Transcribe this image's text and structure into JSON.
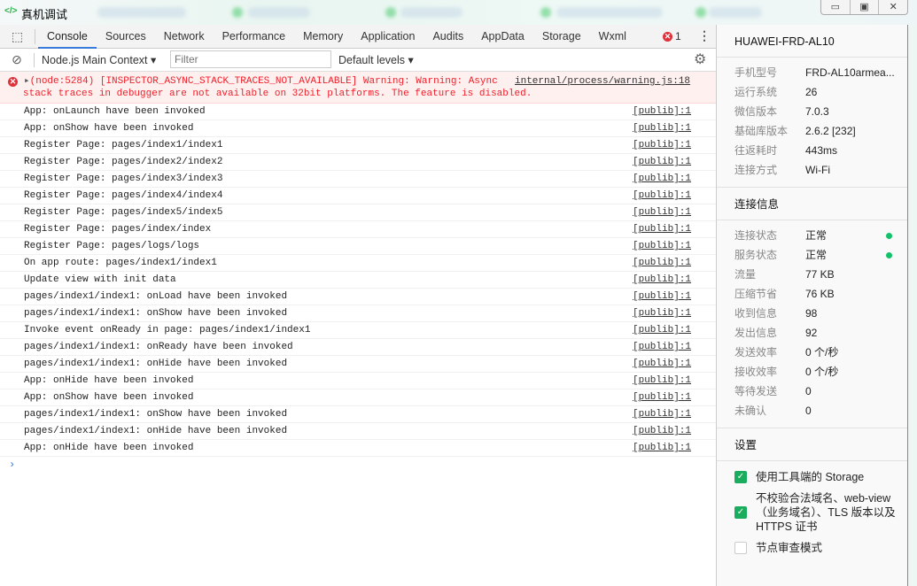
{
  "window": {
    "title": "真机调试",
    "icon": "code-icon",
    "controls": [
      "minimize",
      "maximize",
      "close"
    ]
  },
  "tabs": [
    "Console",
    "Sources",
    "Network",
    "Performance",
    "Memory",
    "Application",
    "Audits",
    "AppData",
    "Storage",
    "Wxml"
  ],
  "active_tab": "Console",
  "error_count": "1",
  "toolbar": {
    "context": "Node.js Main Context",
    "filter_placeholder": "Filter",
    "levels": "Default levels"
  },
  "error_entry": {
    "line1": "(node:5284) [INSPECTOR_ASYNC_STACK_TRACES_NOT_AVAILABLE] Warning: Warning: Async",
    "line2": "stack traces in debugger are not available on 32bit platforms. The feature is disabled.",
    "source": "internal/process/warning.js:18"
  },
  "logs": [
    {
      "msg": "App: onLaunch have been invoked",
      "src": "[publib]:1"
    },
    {
      "msg": "App: onShow have been invoked",
      "src": "[publib]:1"
    },
    {
      "msg": "Register Page: pages/index1/index1",
      "src": "[publib]:1"
    },
    {
      "msg": "Register Page: pages/index2/index2",
      "src": "[publib]:1"
    },
    {
      "msg": "Register Page: pages/index3/index3",
      "src": "[publib]:1"
    },
    {
      "msg": "Register Page: pages/index4/index4",
      "src": "[publib]:1"
    },
    {
      "msg": "Register Page: pages/index5/index5",
      "src": "[publib]:1"
    },
    {
      "msg": "Register Page: pages/index/index",
      "src": "[publib]:1"
    },
    {
      "msg": "Register Page: pages/logs/logs",
      "src": "[publib]:1"
    },
    {
      "msg": "On app route: pages/index1/index1",
      "src": "[publib]:1"
    },
    {
      "msg": "Update view with init data",
      "src": "[publib]:1"
    },
    {
      "msg": "pages/index1/index1: onLoad have been invoked",
      "src": "[publib]:1"
    },
    {
      "msg": "pages/index1/index1: onShow have been invoked",
      "src": "[publib]:1"
    },
    {
      "msg": "Invoke event onReady in page: pages/index1/index1",
      "src": "[publib]:1"
    },
    {
      "msg": "pages/index1/index1: onReady have been invoked",
      "src": "[publib]:1"
    },
    {
      "msg": "pages/index1/index1: onHide have been invoked",
      "src": "[publib]:1"
    },
    {
      "msg": "App: onHide have been invoked",
      "src": "[publib]:1"
    },
    {
      "msg": "App: onShow have been invoked",
      "src": "[publib]:1"
    },
    {
      "msg": "pages/index1/index1: onShow have been invoked",
      "src": "[publib]:1"
    },
    {
      "msg": "pages/index1/index1: onHide have been invoked",
      "src": "[publib]:1"
    },
    {
      "msg": "App: onHide have been invoked",
      "src": "[publib]:1"
    }
  ],
  "side": {
    "device": "HUAWEI-FRD-AL10",
    "info": [
      {
        "k": "手机型号",
        "v": "FRD-AL10armea..."
      },
      {
        "k": "运行系统",
        "v": "26"
      },
      {
        "k": "微信版本",
        "v": "7.0.3"
      },
      {
        "k": "基础库版本",
        "v": "2.6.2 [232]"
      },
      {
        "k": "往返耗时",
        "v": "443ms"
      },
      {
        "k": "连接方式",
        "v": "Wi-Fi"
      }
    ],
    "conn_title": "连接信息",
    "conn": [
      {
        "k": "连接状态",
        "v": "正常",
        "dot": true
      },
      {
        "k": "服务状态",
        "v": "正常",
        "dot": true
      },
      {
        "k": "流量",
        "v": "77 KB"
      },
      {
        "k": "压缩节省",
        "v": "76 KB"
      },
      {
        "k": "收到信息",
        "v": "98"
      },
      {
        "k": "发出信息",
        "v": "92"
      },
      {
        "k": "发送效率",
        "v": "0 个/秒"
      },
      {
        "k": "接收效率",
        "v": "0 个/秒"
      },
      {
        "k": "等待发送",
        "v": "0"
      },
      {
        "k": "未确认",
        "v": "0"
      }
    ],
    "settings_title": "设置",
    "settings": [
      {
        "label": "使用工具端的 Storage",
        "checked": true
      },
      {
        "label": "不校验合法域名、web-view（业务域名）、TLS 版本以及 HTTPS 证书",
        "checked": true
      },
      {
        "label": "节点审查模式",
        "checked": false
      }
    ]
  },
  "colors": {
    "accent": "#3879d9",
    "error": "#f0202a",
    "ok": "#11c26a",
    "check": "#1aad5d"
  }
}
